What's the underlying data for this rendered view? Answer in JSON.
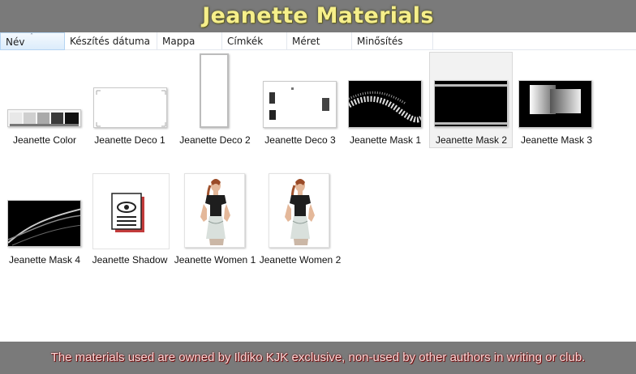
{
  "header": {
    "title": "Jeanette Materials"
  },
  "columns": {
    "name": "Név",
    "date": "Készítés dátuma",
    "folder": "Mappa",
    "tags": "Címkék",
    "size": "Méret",
    "rating": "Minősítés"
  },
  "sort_indicator": "˄",
  "files": [
    {
      "name": "Jeanette Color"
    },
    {
      "name": "Jeanette Deco 1"
    },
    {
      "name": "Jeanette Deco 2"
    },
    {
      "name": "Jeanette Deco 3"
    },
    {
      "name": "Jeanette Mask 1"
    },
    {
      "name": "Jeanette Mask 2",
      "selected": true
    },
    {
      "name": "Jeanette Mask 3"
    },
    {
      "name": "Jeanette Mask 4"
    },
    {
      "name": "Jeanette Shadow"
    },
    {
      "name": "Jeanette Women 1"
    },
    {
      "name": "Jeanette Women 2"
    }
  ],
  "footer": {
    "notice": "The materials used are owned by Ildiko KJK exclusive, non-used by other authors in writing or club."
  },
  "colors": {
    "banner_bg": "#7a7a7a",
    "title_color": "#f6ef8a",
    "footer_text_color": "#ffd7d7"
  }
}
